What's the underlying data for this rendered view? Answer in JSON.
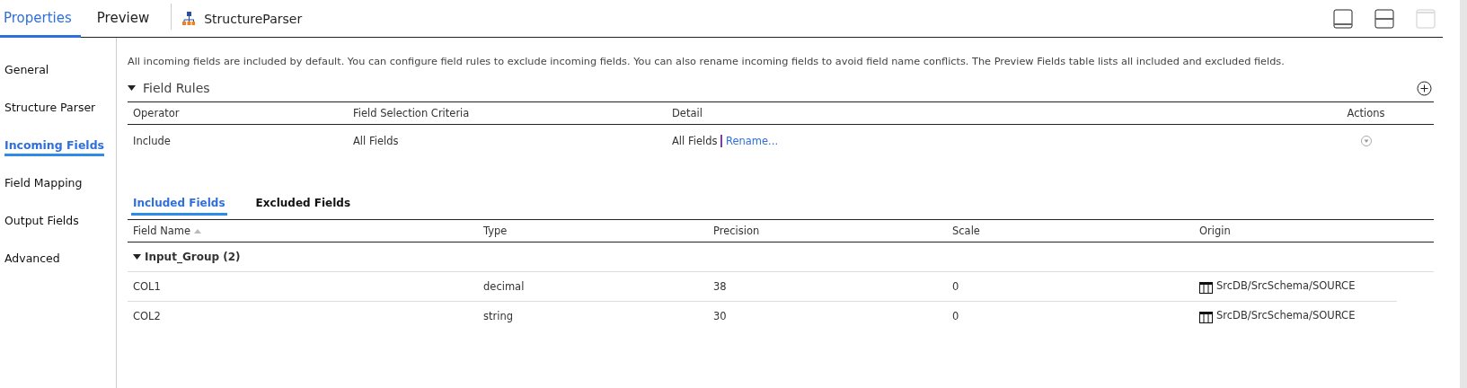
{
  "top_tabs": [
    {
      "label": "Properties",
      "selected": true
    },
    {
      "label": "Preview",
      "selected": false
    }
  ],
  "object_title": "StructureParser",
  "layout_buttons": [
    {
      "kind": "bottom",
      "disabled": false
    },
    {
      "kind": "middle",
      "disabled": false
    },
    {
      "kind": "top",
      "disabled": true
    }
  ],
  "sidebar": {
    "items": [
      {
        "label": "General",
        "selected": false
      },
      {
        "label": "Structure Parser",
        "selected": false
      },
      {
        "label": "Incoming Fields",
        "selected": true
      },
      {
        "label": "Field Mapping",
        "selected": false
      },
      {
        "label": "Output Fields",
        "selected": false
      },
      {
        "label": "Advanced",
        "selected": false
      }
    ]
  },
  "description": "All incoming fields are included by default. You can configure field rules to exclude incoming fields. You can also rename incoming fields to avoid field name conflicts. The Preview Fields table lists all included and excluded fields.",
  "field_rules": {
    "title": "Field Rules",
    "expanded": true,
    "columns": [
      "Operator",
      "Field Selection Criteria",
      "Detail",
      "Actions"
    ],
    "rows": [
      {
        "operator": "Include",
        "criteria": "All Fields",
        "detail": "All Fields",
        "link": "Rename..."
      }
    ]
  },
  "field_tabs": [
    {
      "label": "Included Fields",
      "selected": true
    },
    {
      "label": "Excluded Fields",
      "selected": false
    }
  ],
  "fields_table": {
    "columns": [
      {
        "label": "Field Name",
        "sorted": true
      },
      {
        "label": "Type",
        "sorted": false
      },
      {
        "label": "Precision",
        "sorted": false
      },
      {
        "label": "Scale",
        "sorted": false
      },
      {
        "label": "Origin",
        "sorted": false
      }
    ],
    "groups": [
      {
        "label": "Input_Group (2)",
        "expanded": true,
        "rows": [
          {
            "cells": [
              "COL1",
              "decimal",
              "38",
              "0",
              "SrcDB/SrcSchema/SOURCE"
            ]
          },
          {
            "cells": [
              "COL2",
              "string",
              "30",
              "0",
              "SrcDB/SrcSchema/SOURCE"
            ]
          }
        ]
      }
    ]
  }
}
